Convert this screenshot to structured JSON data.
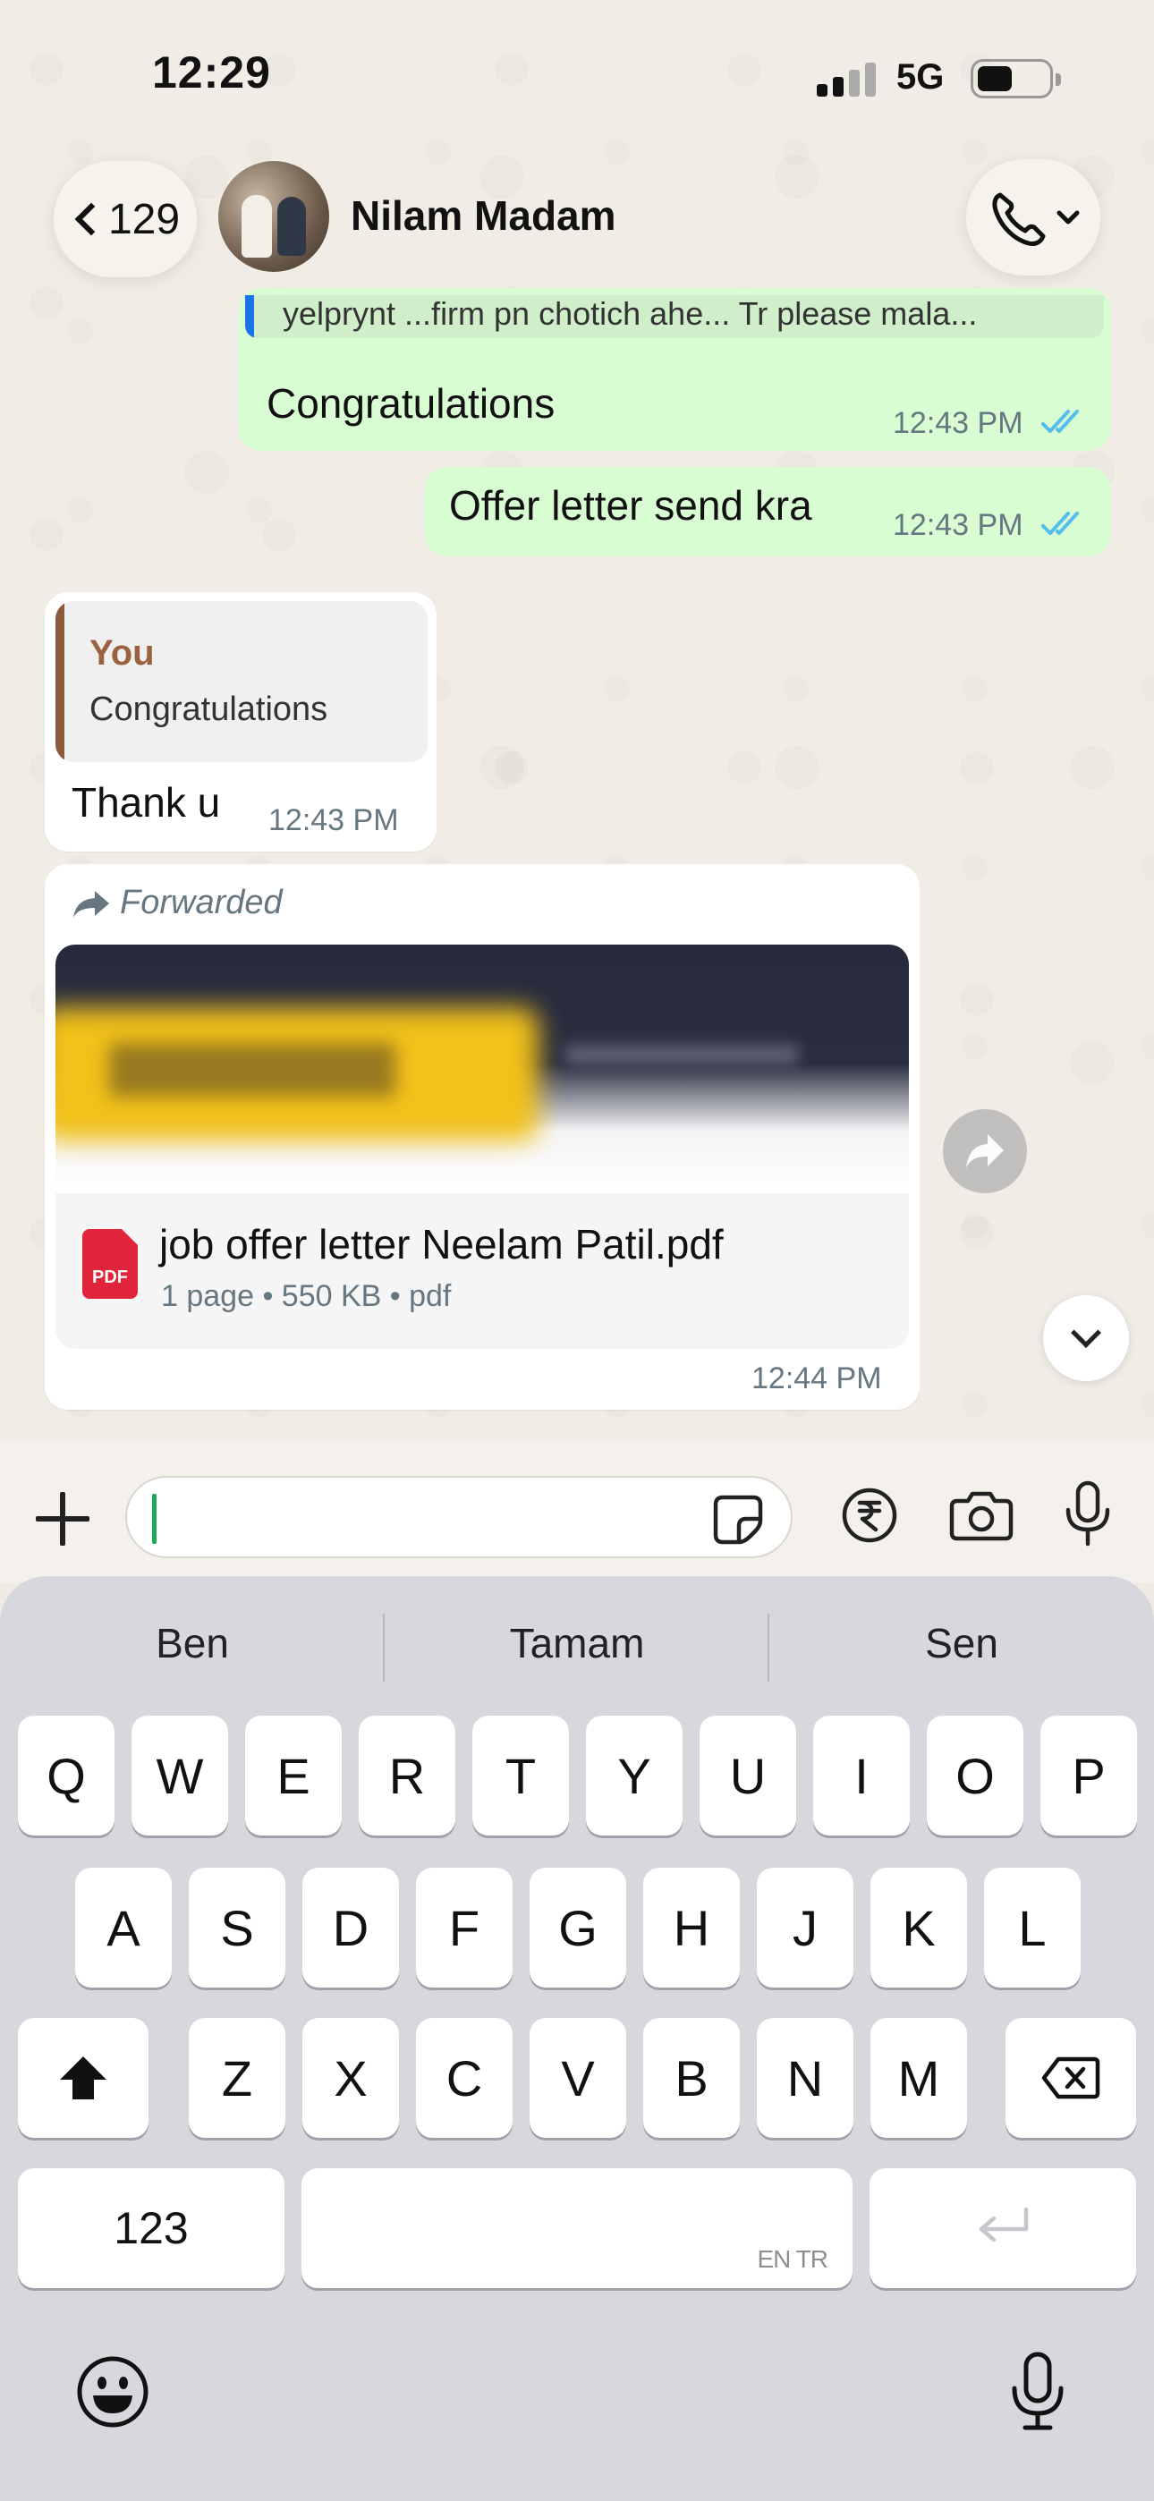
{
  "status_bar": {
    "time": "12:29",
    "network": "5G"
  },
  "header": {
    "back_count": "129",
    "contact_name": "Nilam Madam",
    "icons": [
      "chevron-left-icon",
      "phone-icon",
      "chevron-down-icon"
    ]
  },
  "messages": {
    "quoted_strip_text": "yelprynt ...firm pn chotich ahe... Tr please mala...",
    "msg1": {
      "text": "Congratulations",
      "time": "12:43 PM",
      "status": "read"
    },
    "msg2": {
      "text": "Offer letter send kra",
      "time": "12:43 PM",
      "status": "read"
    },
    "msg3": {
      "reply_author": "You",
      "reply_text": "Congratulations",
      "text": "Thank u",
      "time": "12:43 PM"
    },
    "msg4": {
      "forwarded_label": "Forwarded",
      "pdf_badge": "PDF",
      "file_name": "job offer letter Neelam Patil.pdf",
      "file_meta": "1 page • 550 KB • pdf",
      "time": "12:44 PM"
    }
  },
  "input_bar": {
    "value": "",
    "icons": [
      "plus-icon",
      "sticker-icon",
      "rupee-icon",
      "camera-icon",
      "microphone-icon"
    ]
  },
  "keyboard": {
    "suggestions": [
      "Ben",
      "Tamam",
      "Sen"
    ],
    "row1": [
      "Q",
      "W",
      "E",
      "R",
      "T",
      "Y",
      "U",
      "I",
      "O",
      "P"
    ],
    "row2": [
      "A",
      "S",
      "D",
      "F",
      "G",
      "H",
      "J",
      "K",
      "L"
    ],
    "row3": [
      "Z",
      "X",
      "C",
      "V",
      "B",
      "N",
      "M"
    ],
    "numbers_key": "123",
    "space_hint": "EN TR"
  },
  "colors": {
    "outgoing_bubble": "#d9fdd3",
    "incoming_bubble": "#ffffff",
    "read_ticks": "#53bdeb",
    "reply_author": "#9a6240",
    "pdf_red": "#e0243a",
    "caret_green": "#1fa855"
  }
}
